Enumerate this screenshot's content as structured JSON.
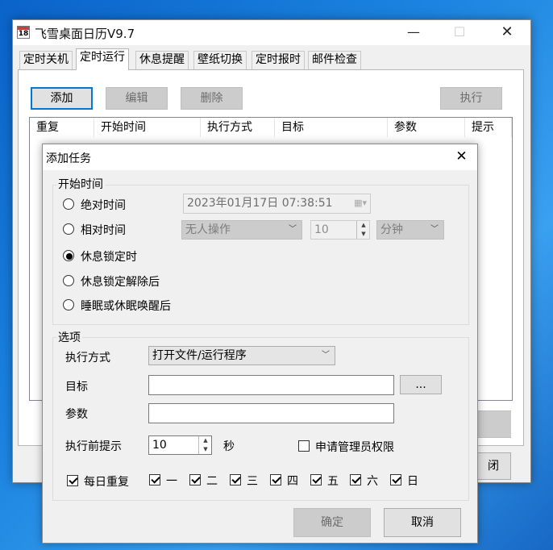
{
  "window": {
    "title": "飞雪桌面日历V9.7",
    "icon_text": "18",
    "minimize": "—",
    "maximize": "☐",
    "close": "✕"
  },
  "tabs": [
    "定时关机",
    "定时运行",
    "休息提醒",
    "壁纸切换",
    "定时报时",
    "邮件检查"
  ],
  "toolbar": {
    "add": "添加",
    "edit": "编辑",
    "delete": "删除",
    "run": "执行"
  },
  "list_columns": [
    "重复",
    "开始时间",
    "执行方式",
    "目标",
    "参数",
    "提示"
  ],
  "main_bottom_button_partial": "闭",
  "dialog": {
    "title": "添加任务",
    "close": "✕",
    "start_group": {
      "legend": "开始时间",
      "absolute": {
        "label": "绝对时间",
        "value": "2023年01月17日  07:38:51"
      },
      "relative": {
        "label": "相对时间",
        "condition": "无人操作",
        "amount": "10",
        "unit": "分钟"
      },
      "rest_lock": "休息锁定时",
      "rest_unlock": "休息锁定解除后",
      "wake": "睡眠或休眠唤醒后",
      "selected": "rest_lock"
    },
    "options_group": {
      "legend": "选项",
      "exec_mode_label": "执行方式",
      "exec_mode_value": "打开文件/运行程序",
      "target_label": "目标",
      "target_value": "",
      "browse": "...",
      "params_label": "参数",
      "params_value": "",
      "prompt_label": "执行前提示",
      "prompt_value": "10",
      "prompt_unit": "秒",
      "admin_label": "申请管理员权限",
      "admin_checked": false,
      "daily_label": "每日重复",
      "daily_checked": true,
      "weekdays": [
        "一",
        "二",
        "三",
        "四",
        "五",
        "六",
        "日"
      ]
    },
    "ok": "确定",
    "cancel": "取消"
  }
}
